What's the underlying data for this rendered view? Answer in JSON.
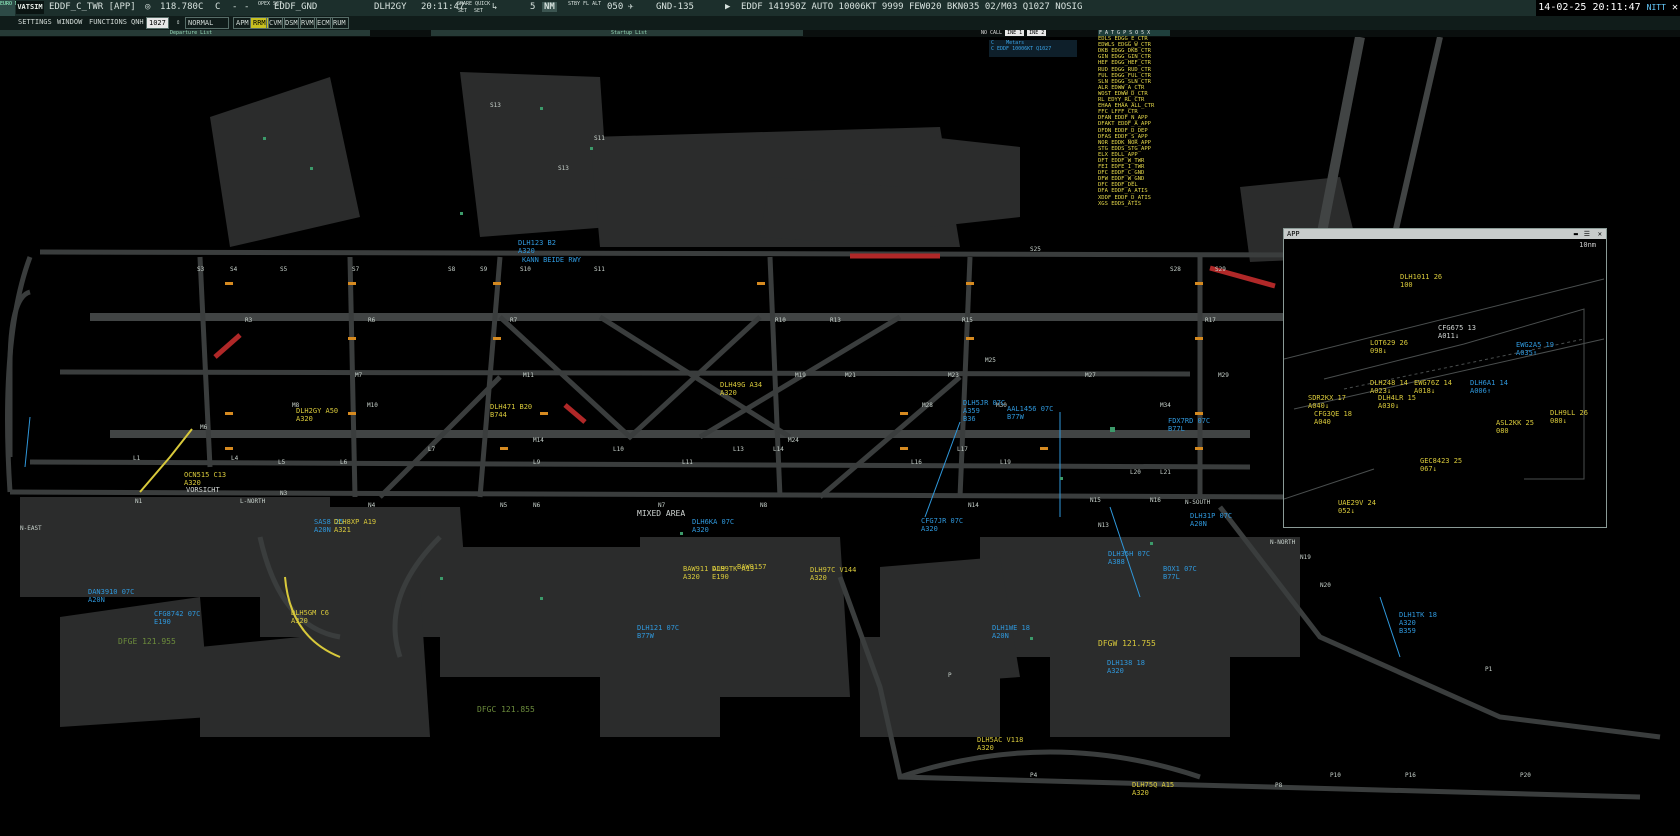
{
  "topbar": {
    "logo": "EURO MENU",
    "vatsim": "VATSIM",
    "callsign": "EDDF_C_TWR [APP]",
    "freq": "118.780",
    "c1": "C",
    "c2": "C",
    "dash1": "-",
    "dash2": "-",
    "open_sct": "OPEX SCT",
    "sector": "EDDF_GND",
    "aircraft": "DLH2GY",
    "time": "20:11:47",
    "spare_quick": "SPARE QUICK",
    "set1": "SET",
    "set2": "SET",
    "five": "5",
    "nm": "NM",
    "stby_fl_alt": "STBY FL ALT",
    "alt_val": "050",
    "gnd": "GND-135",
    "metar": "EDDF 141950Z AUTO 10006KT 9999 FEW020 BKN035 02/M03 Q1027 NOSIG",
    "datetime": "14-02-25 20:11:47",
    "user": "NITT"
  },
  "menubar": {
    "settings": "SETTINGS",
    "window": "WINDOW",
    "functions": "FUNCTIONS",
    "qnh_label": "QNH",
    "qnh_val": "1027",
    "mode": "NORMAL",
    "toggles": [
      "APM",
      "RRM",
      "CVM",
      "DSM",
      "RVM",
      "ECM",
      "RUM"
    ]
  },
  "subbar": {
    "departure_list": "Departure List",
    "startup_list": "Startup List"
  },
  "metar_window": {
    "no_call": "NO CALL",
    "tab1": "INE 1",
    "tab2": "INE 2",
    "col_c": "C",
    "col_metars": "Metars",
    "entry": "C EDDF 10006KT Q1027"
  },
  "atc_list": {
    "header": "F A T G P S O 5 X",
    "items": [
      "EDLS EDGG_E_CTR",
      "EDWLS EDGG_W_CTR",
      "DKB EDGG_DKB_CTR",
      "GIN EDGG_GIN_CTR",
      "HEF EDGG_HEF_CTR",
      "RUD EDGG_RUD_CTR",
      "FUL EDGG_FUL_CTR",
      "SLN EDGG_SLN_CTR",
      "ALR EDWW_A_CTR",
      "WOST EDWW_D_CTR",
      "RL EDYY_RL_CTR",
      "EHAA EHAA_ALL_CTR",
      "FFC LFFF_CTR",
      "DFAN EDDF_N_APP",
      "DFAKT EDDF_A_APP",
      "DFDN EDDF_D_DEP",
      "DFAS EDDF_S_APP",
      "NOR EDDK_NOR_APP",
      "STG EDDS_STG_APP",
      "ELX EDLL_APP",
      "DFT EDDF_W_TWR",
      "FEI EDFE_I_TWR",
      "DFC EDDF_C_GND",
      "DFW EDDF_W_GND",
      "DFC EDDF_DEL",
      "DFA EDDF_A_ATIS",
      "XDDF EDDF_D_ATIS",
      "XGS EDDS_ATIS"
    ]
  },
  "app_window": {
    "title": "APP",
    "range": "10nm",
    "targets": [
      {
        "text": "DLH1011 26\n100",
        "color": "yel"
      },
      {
        "text": "CFG675 13\nA011↓",
        "color": "wht"
      },
      {
        "text": "LOT629 26\n098↓",
        "color": "yel"
      },
      {
        "text": "EWG2A5 19\nA035↑",
        "color": "blu"
      },
      {
        "text": "DLH248 14\nA023↓",
        "color": "yel"
      },
      {
        "text": "EWG76Z 14\nA018↓",
        "color": "yel"
      },
      {
        "text": "DLH6A1 14\nA006↑",
        "color": "blu"
      },
      {
        "text": "SDR2KX 17\nA040↓",
        "color": "yel"
      },
      {
        "text": "DLH4LR 15\nA030↓",
        "color": "yel"
      },
      {
        "text": "CFG3QE 18\nA040",
        "color": "yel"
      },
      {
        "text": "DLH9LL 26\n080↓",
        "color": "yel"
      },
      {
        "text": "ASL2KK 25\n080",
        "color": "yel"
      },
      {
        "text": "GEC8423 25\n067↓",
        "color": "yel"
      },
      {
        "text": "UAE29V 24\n052↓",
        "color": "yel"
      }
    ]
  },
  "ground_labels": [
    {
      "text": "DLH123 B2\nA320",
      "color": "blu"
    },
    {
      "text": "KANN BEIDE RWY",
      "color": "blu"
    },
    {
      "text": "DLH2GY A50\nA320",
      "color": "yel"
    },
    {
      "text": "DLH471 B20\nB744",
      "color": "yel"
    },
    {
      "text": "DLH49G A34\nA320",
      "color": "yel"
    },
    {
      "text": "DLH5JR 07C\nA359\nB36",
      "color": "blu"
    },
    {
      "text": "AAL1456 07C\nB77W",
      "color": "blu"
    },
    {
      "text": "FDX7RD 07C\nB77L",
      "color": "blu"
    },
    {
      "text": "OCN515 C13\nA320",
      "color": "yel"
    },
    {
      "text": "VORSICHT",
      "color": "wht"
    },
    {
      "text": "SAS8 25\nA20N",
      "color": "blu"
    },
    {
      "text": "DLH8XP A19\nA321",
      "color": "yel"
    },
    {
      "text": "MIXED AREA",
      "color": "wht"
    },
    {
      "text": "DLH6KA 07C\nA320",
      "color": "blu"
    },
    {
      "text": "CFG7JR 07C\nA320",
      "color": "blu"
    },
    {
      "text": "DLH31P 07C\nA20N",
      "color": "blu"
    },
    {
      "text": "DLH35H 07C\nA388",
      "color": "blu"
    },
    {
      "text": "BOX1 07C\nB77L",
      "color": "blu"
    },
    {
      "text": "BAW911 A19\nA320",
      "color": "yel"
    },
    {
      "text": "DLH9TK A19\nE190",
      "color": "yel"
    },
    {
      "text": "BAW9157",
      "color": "yel"
    },
    {
      "text": "DLH97C V144\nA320",
      "color": "yel"
    },
    {
      "text": "DAN3910 07C\nA20N",
      "color": "blu"
    },
    {
      "text": "CFG8742 07C\nE190",
      "color": "blu"
    },
    {
      "text": "DLH5GM C6\nA320",
      "color": "yel"
    },
    {
      "text": "DFGE 121.955",
      "color": "grn"
    },
    {
      "text": "DLH121 07C\nB77W",
      "color": "blu"
    },
    {
      "text": "DLH1WE 18\nA20N",
      "color": "blu"
    },
    {
      "text": "DFGW 121.755",
      "color": "yel"
    },
    {
      "text": "DLH138 18\nA320",
      "color": "blu"
    },
    {
      "text": "DLH1TK 18\nA320\nB359",
      "color": "blu"
    },
    {
      "text": "DFGC 121.855",
      "color": "grn"
    },
    {
      "text": "DLH5AC V118\nA320",
      "color": "yel"
    },
    {
      "text": "DLH75Q A15\nA320",
      "color": "yel"
    }
  ]
}
